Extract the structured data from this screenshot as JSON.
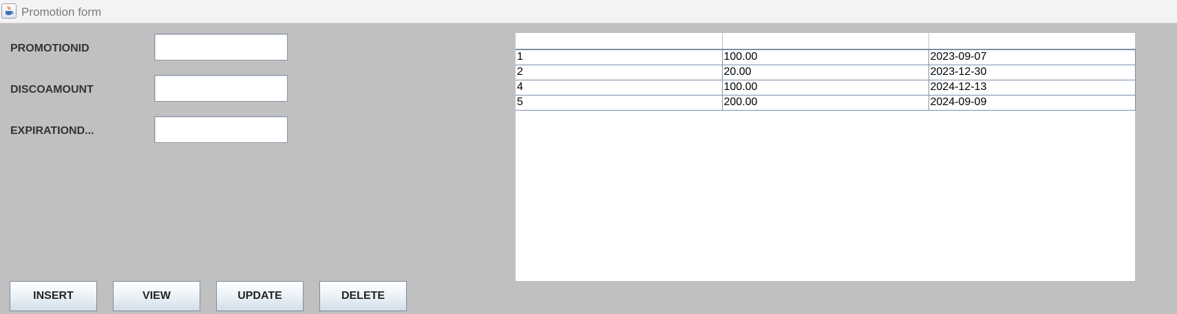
{
  "window": {
    "title": "Promotion form",
    "icon": "java-cup-icon"
  },
  "form": {
    "fields": [
      {
        "label": "PROMOTIONID",
        "value": ""
      },
      {
        "label": "DISCOAMOUNT",
        "value": ""
      },
      {
        "label": "EXPIRATIOND...",
        "value": ""
      }
    ]
  },
  "buttons": {
    "insert": "INSERT",
    "view": "VIEW",
    "update": "UPDATE",
    "delete": "DELETE"
  },
  "table": {
    "columns": [
      "",
      "",
      ""
    ],
    "rows": [
      [
        "1",
        "100.00",
        "2023-09-07"
      ],
      [
        "2",
        "20.00",
        "2023-12-30"
      ],
      [
        "4",
        "100.00",
        "2024-12-13"
      ],
      [
        "5",
        "200.00",
        "2024-09-09"
      ]
    ]
  }
}
